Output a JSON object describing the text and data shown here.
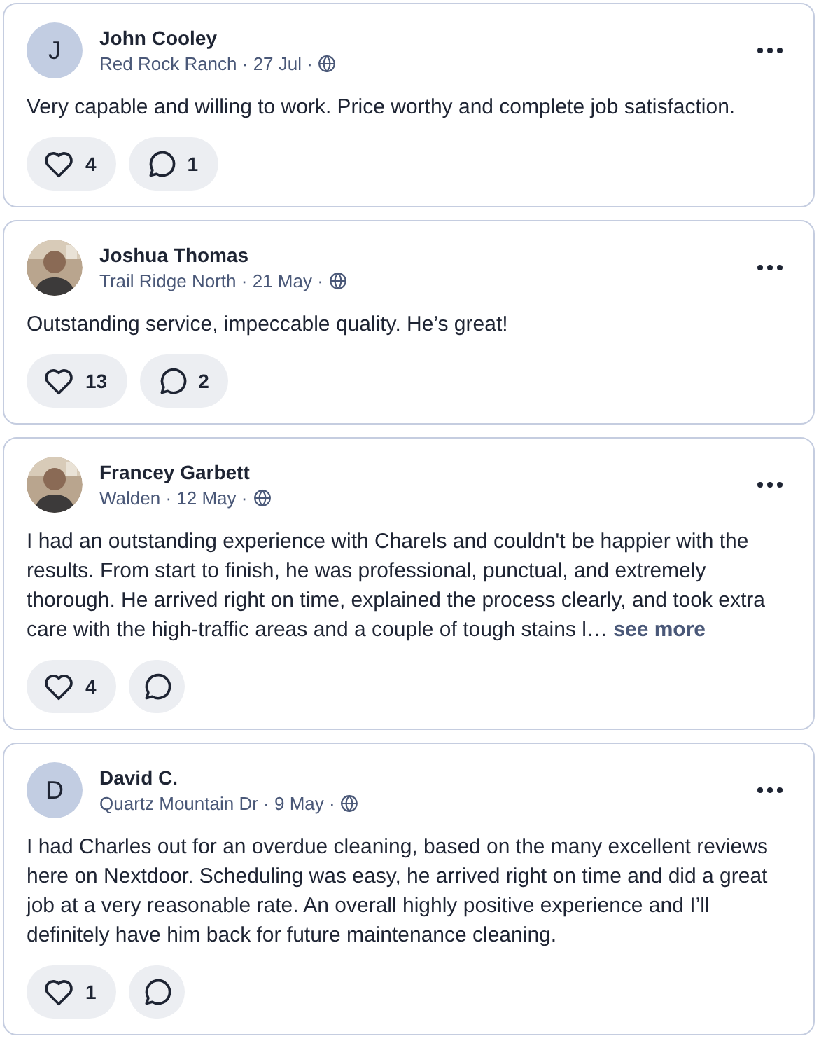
{
  "posts": [
    {
      "author": "John Cooley",
      "avatar": {
        "kind": "initial",
        "letter": "J"
      },
      "meta": "Red Rock Ranch · 27 Jul ·",
      "text": "Very capable and willing to work. Price worthy and complete job satisfaction.",
      "likes": "4",
      "comments": "1"
    },
    {
      "author": "Joshua Thomas",
      "meta": "Trail Ridge North · 21 May ·",
      "text": "Outstanding service, impeccable quality.  He’s great!",
      "likes": "13",
      "comments": "2"
    },
    {
      "author": "Francey Garbett",
      "meta": "Walden · 12 May ·",
      "text": "I had an outstanding experience with Charels and couldn't be happier with the results. From start to finish, he was professional, punctual, and extremely thorough. He arrived right on time, explained the process clearly, and took extra care with the high-traffic areas and a couple of tough stains l…",
      "see_more": "see more",
      "likes": "4"
    },
    {
      "author": "David C.",
      "avatar": {
        "kind": "initial",
        "letter": "D"
      },
      "meta": "Quartz Mountain Dr · 9 May ·",
      "text": "I had Charles out for an overdue cleaning, based on the many excellent reviews here on Nextdoor. Scheduling was easy, he arrived right on time and did a great job at a very reasonable rate. An overall highly positive experience and I’ll definitely have him back for future maintenance cleaning.",
      "likes": "1"
    }
  ]
}
